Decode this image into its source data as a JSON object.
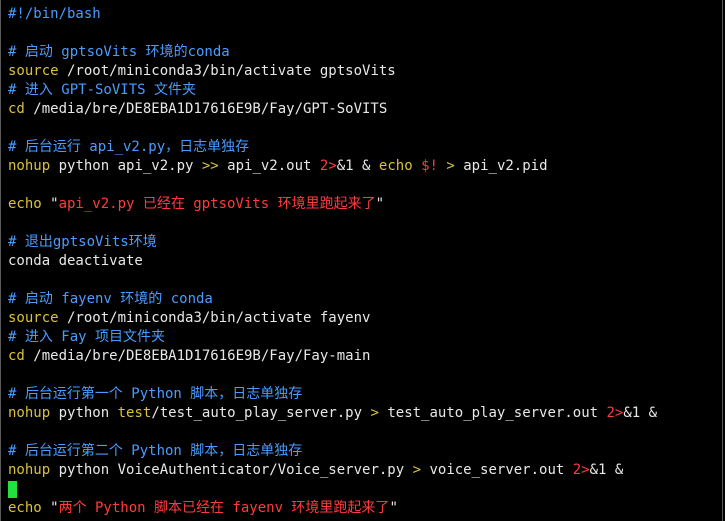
{
  "terminal": {
    "lines": [
      [
        {
          "t": "#!/bin/bash",
          "c": "blue"
        }
      ],
      [],
      [
        {
          "t": "# 启动 gptsoVits 环境的conda",
          "c": "blue"
        }
      ],
      [
        {
          "t": "source",
          "c": "yellow"
        },
        {
          "t": " /root/miniconda3/bin/activate gptsoVits",
          "c": "white"
        }
      ],
      [
        {
          "t": "# 进入 GPT-SoVITS 文件夹",
          "c": "blue"
        }
      ],
      [
        {
          "t": "cd",
          "c": "yellow"
        },
        {
          "t": " /media/bre/DE8EBA1D17616E9B/Fay/GPT-SoVITS",
          "c": "white"
        }
      ],
      [],
      [
        {
          "t": "# 后台运行 api_v2.py，日志单独存",
          "c": "blue"
        }
      ],
      [
        {
          "t": "nohup",
          "c": "yellow"
        },
        {
          "t": " python api_v2.py ",
          "c": "white"
        },
        {
          "t": ">>",
          "c": "yellow"
        },
        {
          "t": " api_v2.out ",
          "c": "white"
        },
        {
          "t": "2>",
          "c": "red"
        },
        {
          "t": "&1 & ",
          "c": "white"
        },
        {
          "t": "echo",
          "c": "yellow"
        },
        {
          "t": " ",
          "c": "white"
        },
        {
          "t": "$!",
          "c": "red"
        },
        {
          "t": " ",
          "c": "white"
        },
        {
          "t": ">",
          "c": "yellow"
        },
        {
          "t": " api_v2.pid",
          "c": "white"
        }
      ],
      [],
      [
        {
          "t": "echo",
          "c": "yellow"
        },
        {
          "t": " \"",
          "c": "white"
        },
        {
          "t": "api_v2.py 已经在 gptsoVits 环境里跑起来了",
          "c": "red"
        },
        {
          "t": "\"",
          "c": "white"
        }
      ],
      [],
      [
        {
          "t": "# 退出gptsoVits环境",
          "c": "blue"
        }
      ],
      [
        {
          "t": "conda deactivate",
          "c": "white"
        }
      ],
      [],
      [
        {
          "t": "# 启动 fayenv 环境的 conda",
          "c": "blue"
        }
      ],
      [
        {
          "t": "source",
          "c": "yellow"
        },
        {
          "t": " /root/miniconda3/bin/activate fayenv",
          "c": "white"
        }
      ],
      [
        {
          "t": "# 进入 Fay 项目文件夹",
          "c": "blue"
        }
      ],
      [
        {
          "t": "cd",
          "c": "yellow"
        },
        {
          "t": " /media/bre/DE8EBA1D17616E9B/Fay/Fay-main",
          "c": "white"
        }
      ],
      [],
      [
        {
          "t": "# 后台运行第一个 Python 脚本，日志单独存",
          "c": "blue"
        }
      ],
      [
        {
          "t": "nohup",
          "c": "yellow"
        },
        {
          "t": " python ",
          "c": "white"
        },
        {
          "t": "test",
          "c": "yellow"
        },
        {
          "t": "/test_auto_play_server.py ",
          "c": "white"
        },
        {
          "t": ">",
          "c": "yellow"
        },
        {
          "t": " test_auto_play_server.out ",
          "c": "white"
        },
        {
          "t": "2>",
          "c": "red"
        },
        {
          "t": "&1 &",
          "c": "white"
        }
      ],
      [],
      [
        {
          "t": "# 后台运行第二个 Python 脚本，日志单独存",
          "c": "blue"
        }
      ],
      [
        {
          "t": "nohup",
          "c": "yellow"
        },
        {
          "t": " python VoiceAuthenticator/Voice_server.py ",
          "c": "white"
        },
        {
          "t": ">",
          "c": "yellow"
        },
        {
          "t": " voice_server.out ",
          "c": "white"
        },
        {
          "t": "2>",
          "c": "red"
        },
        {
          "t": "&1 &",
          "c": "white"
        }
      ],
      [
        {
          "cursor": true
        }
      ],
      [
        {
          "t": "echo",
          "c": "yellow"
        },
        {
          "t": " \"",
          "c": "white"
        },
        {
          "t": "两个 Python 脚本已经在 fayenv 环境里跑起来了",
          "c": "red"
        },
        {
          "t": "\"",
          "c": "white"
        }
      ]
    ]
  },
  "colors": {
    "background": "#000000",
    "comment": "#4a9cff",
    "keyword": "#d9c23c",
    "string": "#ff3b3b",
    "text": "#e8e8e8",
    "cursor": "#22e040"
  }
}
